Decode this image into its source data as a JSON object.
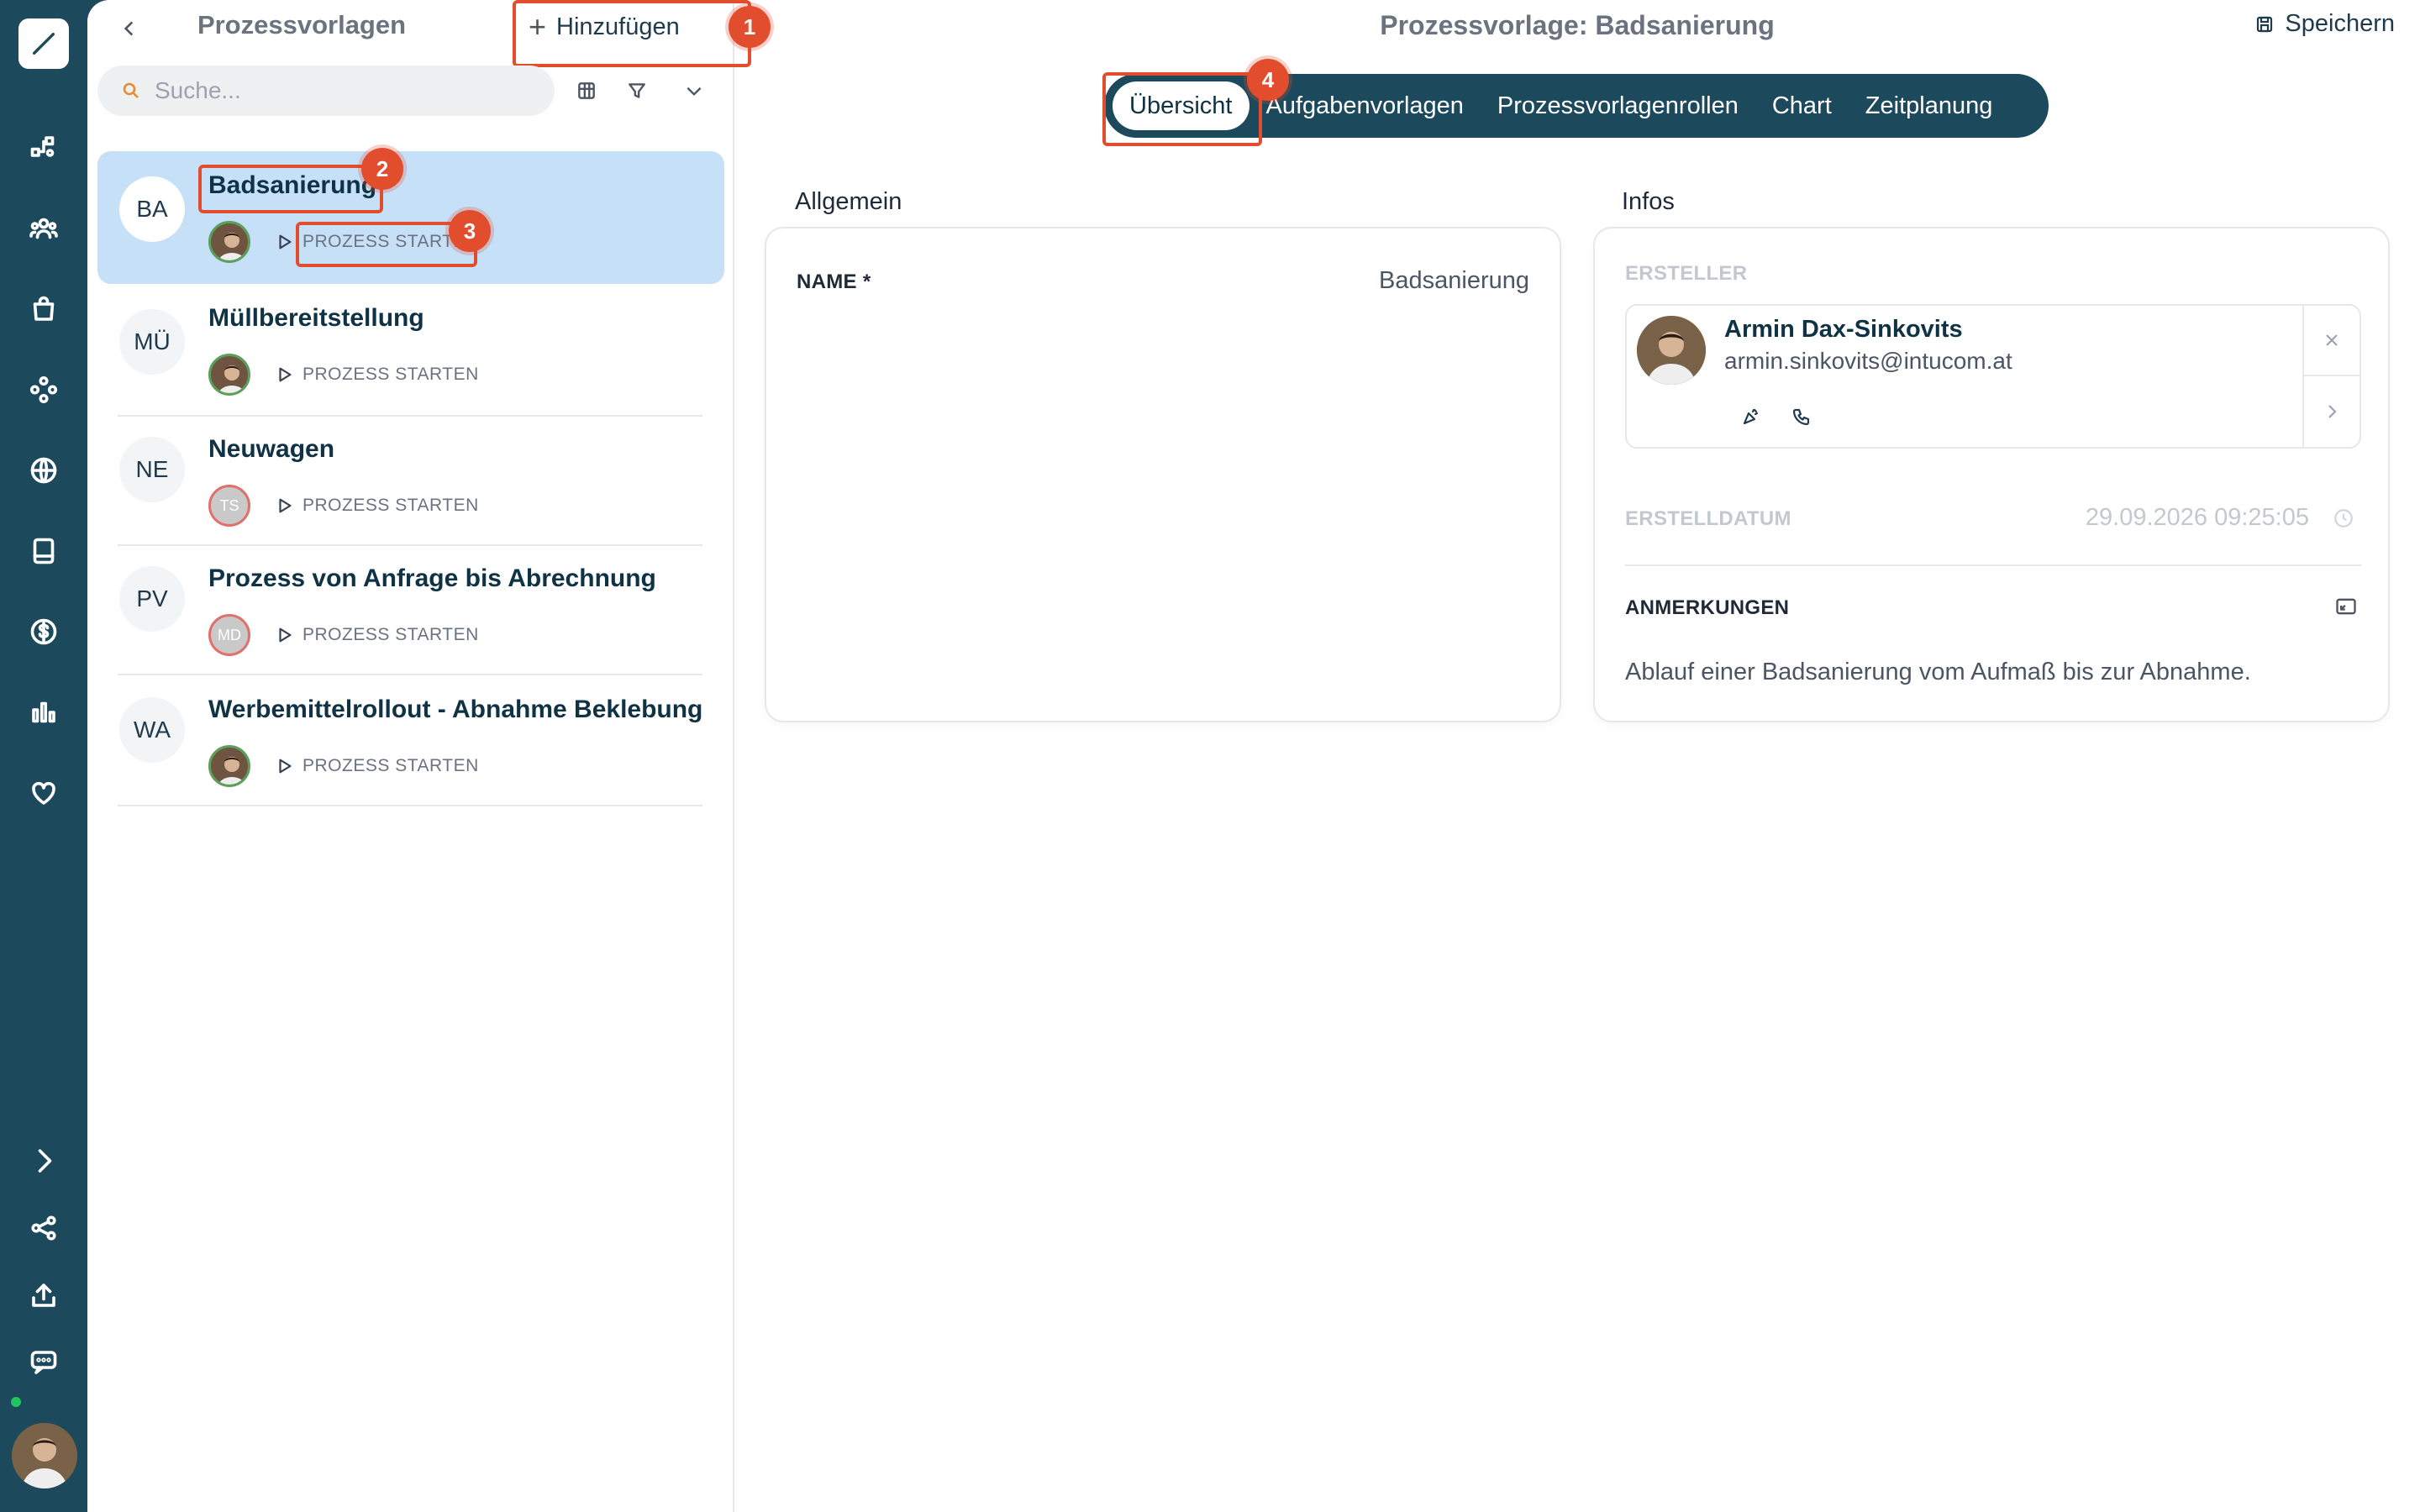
{
  "rail": {
    "items": [
      "logo-icon",
      "process-icon",
      "users-icon",
      "bag-icon",
      "network-icon",
      "globe-icon",
      "book-icon",
      "dollar-icon",
      "chart-icon",
      "heart-icon",
      "expand-icon",
      "share-icon",
      "upload-icon",
      "chat-icon"
    ]
  },
  "list": {
    "title": "Prozessvorlagen",
    "add_label": "Hinzufügen",
    "search_placeholder": "Suche...",
    "items": [
      {
        "initials": "BA",
        "title": "Badsanierung",
        "owner": "photo",
        "start": "PROZESS STARTEN"
      },
      {
        "initials": "MÜ",
        "title": "Müllbereitstellung",
        "owner": "photo",
        "start": "PROZESS STARTEN"
      },
      {
        "initials": "NE",
        "title": "Neuwagen",
        "owner_initials": "TS",
        "start": "PROZESS STARTEN"
      },
      {
        "initials": "PV",
        "title": "Prozess von Anfrage bis Abrechnung",
        "owner_initials": "MD",
        "start": "PROZESS STARTEN"
      },
      {
        "initials": "WA",
        "title": "Werbemittelrollout - Abnahme Beklebung",
        "owner": "photo",
        "start": "PROZESS STARTEN"
      }
    ]
  },
  "detail": {
    "title": "Prozessvorlage: Badsanierung",
    "save_label": "Speichern",
    "tabs": [
      "Übersicht",
      "Aufgabenvorlagen",
      "Prozessvorlagenrollen",
      "Chart",
      "Zeitplanung"
    ],
    "general": {
      "section": "Allgemein",
      "name_label": "NAME *",
      "name_value": "Badsanierung"
    },
    "infos": {
      "section": "Infos",
      "creator_label": "ERSTELLER",
      "creator_name": "Armin Dax-Sinkovits",
      "creator_email": "armin.sinkovits@intucom.at",
      "created_label": "ERSTELLDATUM",
      "created_value": "29.09.2026 09:25:05",
      "notes_label": "ANMERKUNGEN",
      "notes_value": "Ablauf einer Badsanierung vom Aufmaß bis zur Abnahme."
    }
  },
  "annotations": [
    "1",
    "2",
    "3",
    "4"
  ],
  "colors": {
    "rail": "#1c4a5c",
    "accent": "#e24d2d",
    "selected": "#c6e0f8"
  }
}
